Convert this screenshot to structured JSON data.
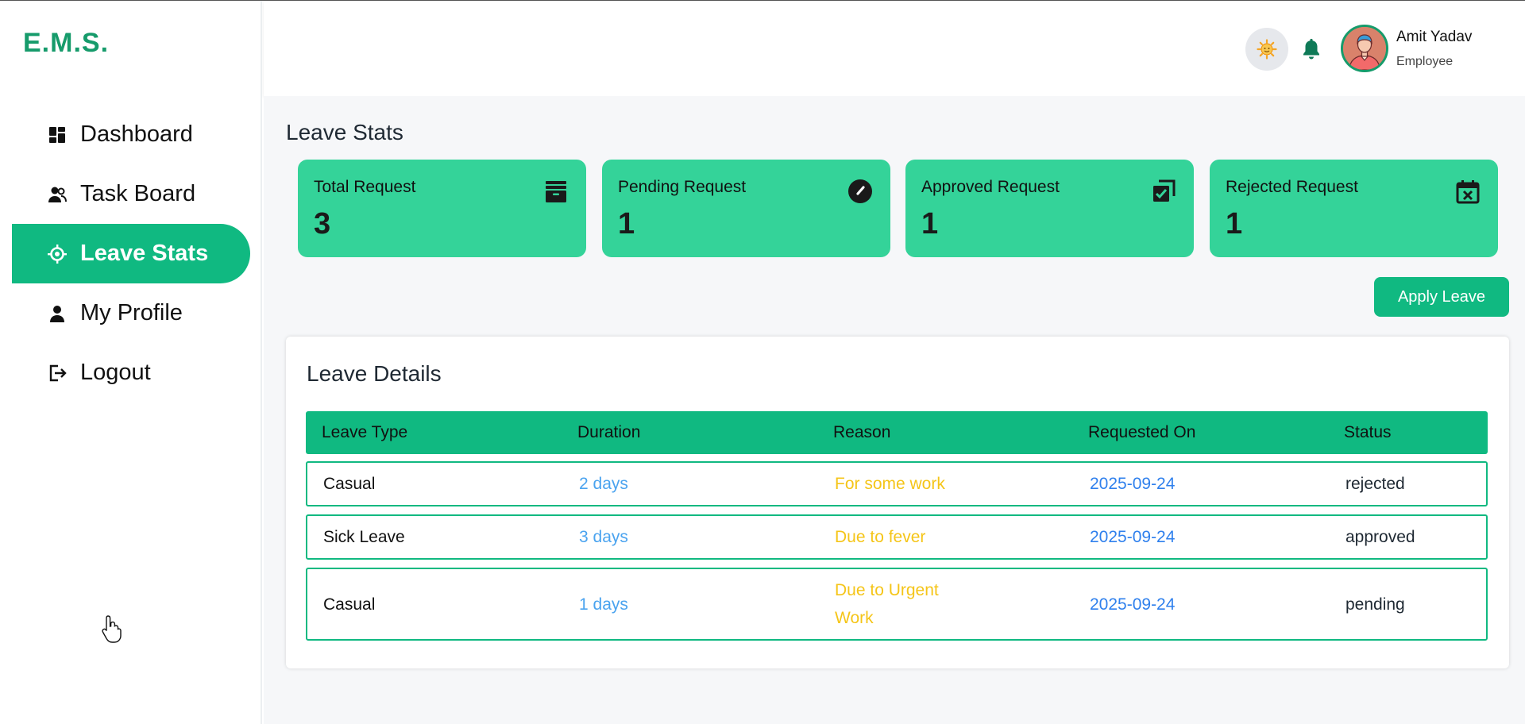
{
  "app": {
    "logo": "E.M.S."
  },
  "sidebar": {
    "items": [
      {
        "label": "Dashboard",
        "icon": "dashboard-icon",
        "active": false
      },
      {
        "label": "Task Board",
        "icon": "users-icon",
        "active": false
      },
      {
        "label": "Leave Stats",
        "icon": "crosshair-icon",
        "active": true
      },
      {
        "label": "My Profile",
        "icon": "user-icon",
        "active": false
      },
      {
        "label": "Logout",
        "icon": "logout-icon",
        "active": false
      }
    ]
  },
  "header": {
    "theme_icon": "sun-icon",
    "bell_icon": "bell-icon",
    "user": {
      "name": "Amit Yadav",
      "role": "Employee"
    }
  },
  "main": {
    "title": "Leave Stats",
    "stats": [
      {
        "label": "Total Request",
        "value": "3",
        "icon": "archive-icon"
      },
      {
        "label": "Pending Request",
        "value": "1",
        "icon": "gauge-icon"
      },
      {
        "label": "Approved Request",
        "value": "1",
        "icon": "copy-check-icon"
      },
      {
        "label": "Rejected Request",
        "value": "1",
        "icon": "calendar-x-icon"
      }
    ],
    "apply_label": "Apply Leave",
    "details": {
      "title": "Leave Details",
      "columns": [
        "Leave Type",
        "Duration",
        "Reason",
        "Requested On",
        "Status"
      ],
      "rows": [
        {
          "type": "Casual",
          "duration": "2 days",
          "reason": "For some work",
          "requested_on": "2025-09-24",
          "status": "rejected"
        },
        {
          "type": "Sick Leave",
          "duration": "3 days",
          "reason": "Due to fever",
          "requested_on": "2025-09-24",
          "status": "approved"
        },
        {
          "type": "Casual",
          "duration": "1 days",
          "reason": "Due to Urgent Work",
          "requested_on": "2025-09-24",
          "status": "pending"
        }
      ]
    }
  },
  "colors": {
    "brand": "#10b981",
    "card": "#34d399",
    "logo": "#169b6b",
    "duration": "#4aa3ef",
    "reason": "#f5c518",
    "date": "#2f80ed"
  }
}
